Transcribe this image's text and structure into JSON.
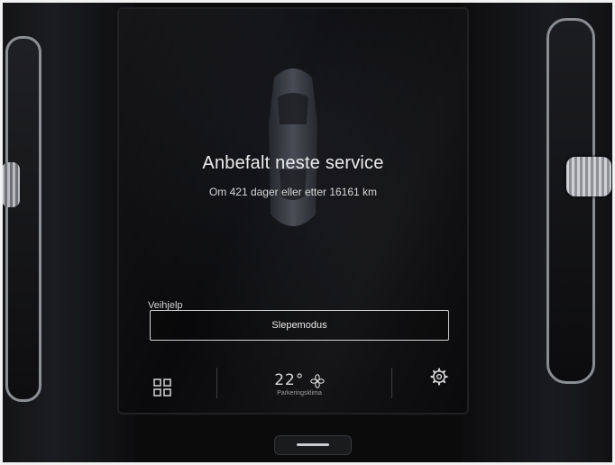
{
  "service": {
    "title": "Anbefalt neste service",
    "subtitle": "Om 421 dager eller etter 16161 km"
  },
  "assistance": {
    "label": "Veihjelp",
    "button_label": "Slepemodus"
  },
  "bottom_bar": {
    "apps_icon": "apps-grid-icon",
    "temperature": "22°",
    "fan_icon": "fan-icon",
    "climate_label": "Parkeringsklima",
    "settings_icon": "gear-icon"
  },
  "colors": {
    "screen_bg": "#0a0a0c",
    "text": "#ececec",
    "border": "#cfcfcf"
  }
}
